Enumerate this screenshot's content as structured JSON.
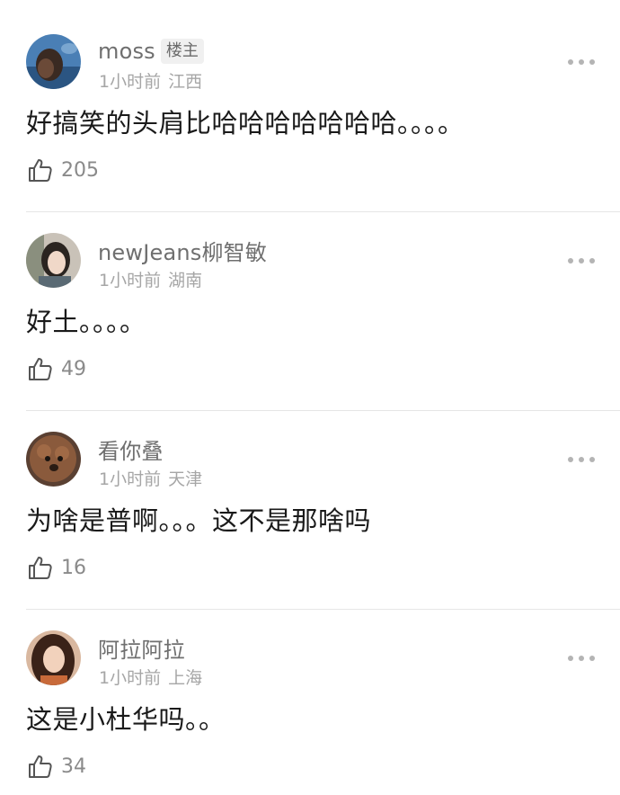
{
  "comments": [
    {
      "username": "moss",
      "badge": "楼主",
      "time": "1小时前",
      "location": "江西",
      "text": "好搞笑的头肩比哈哈哈哈哈哈哈。。。。",
      "likes": "205"
    },
    {
      "username": "newJeans柳智敏",
      "time": "1小时前",
      "location": "湖南",
      "text": "好土。。。。",
      "likes": "49"
    },
    {
      "username": "看你叠",
      "time": "1小时前",
      "location": "天津",
      "text": "为啥是普啊。。。这不是那啥吗",
      "likes": "16"
    },
    {
      "username": "阿拉阿拉",
      "time": "1小时前",
      "location": "上海",
      "text": "这是小杜华吗。。",
      "likes": "34"
    }
  ],
  "icons": {
    "like": "thumbs-up-icon",
    "more": "more-horizontal-icon"
  },
  "colors": {
    "username": "#6f6f6f",
    "meta": "#a6a6a6",
    "body_text": "#1a1a1a",
    "divider": "#e6e6e6",
    "badge_bg": "#f0f0f0"
  }
}
